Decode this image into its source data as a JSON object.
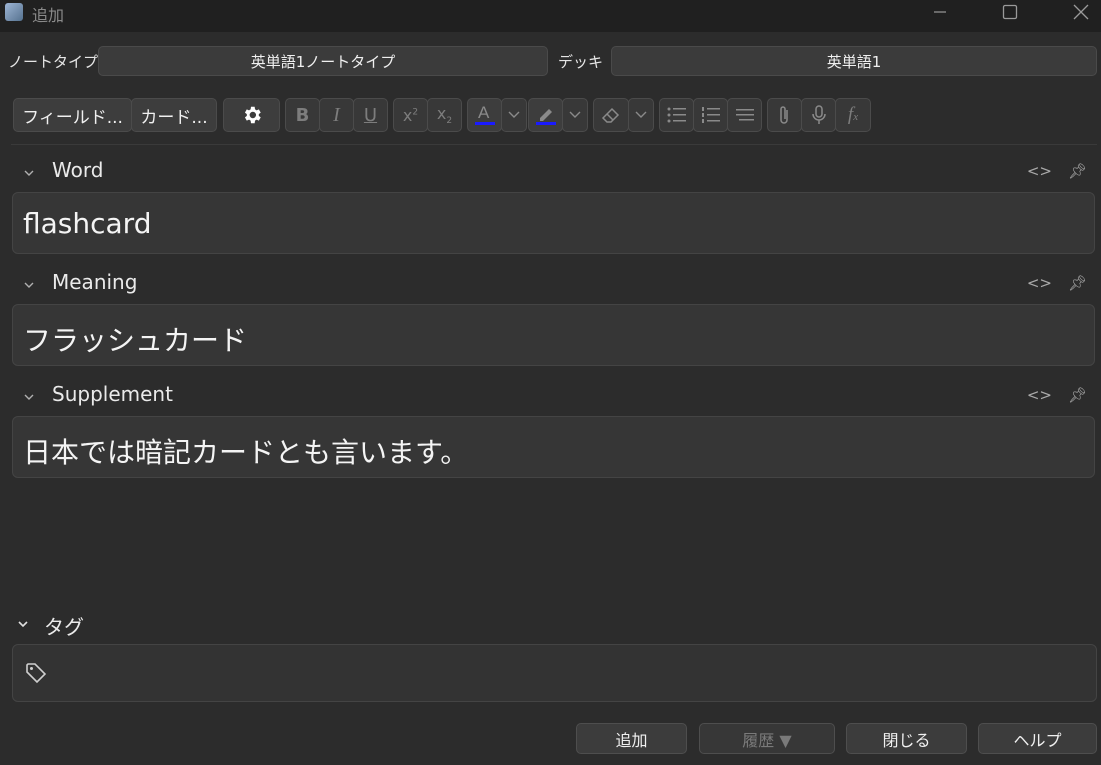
{
  "window": {
    "title": "追加",
    "minimize_icon": "minimize-icon",
    "maximize_icon": "maximize-icon",
    "close_icon": "close-icon"
  },
  "selectors": {
    "notetype_label": "ノートタイプ",
    "notetype_value": "英単語1ノートタイプ",
    "deck_label": "デッキ",
    "deck_value": "英単語1"
  },
  "toolbar": {
    "fields_label": "フィールド...",
    "cards_label": "カード...",
    "icons": [
      "gear-icon",
      "bold-icon",
      "italic-icon",
      "underline-icon",
      "superscript-icon",
      "subscript-icon",
      "text-color-icon",
      "highlight-icon",
      "eraser-icon",
      "bullet-list-icon",
      "numbered-list-icon",
      "align-icon",
      "paperclip-icon",
      "microphone-icon",
      "formula-icon"
    ],
    "accent_color": "#1a1aff"
  },
  "fields": [
    {
      "name": "Word",
      "value": "flashcard"
    },
    {
      "name": "Meaning",
      "value": "フラッシュカード"
    },
    {
      "name": "Supplement",
      "value": "日本では暗記カードとも言います。"
    }
  ],
  "tags": {
    "label": "タグ"
  },
  "buttons": {
    "add": "追加",
    "history": "履歴 ▼",
    "close": "閉じる",
    "help": "ヘルプ"
  }
}
